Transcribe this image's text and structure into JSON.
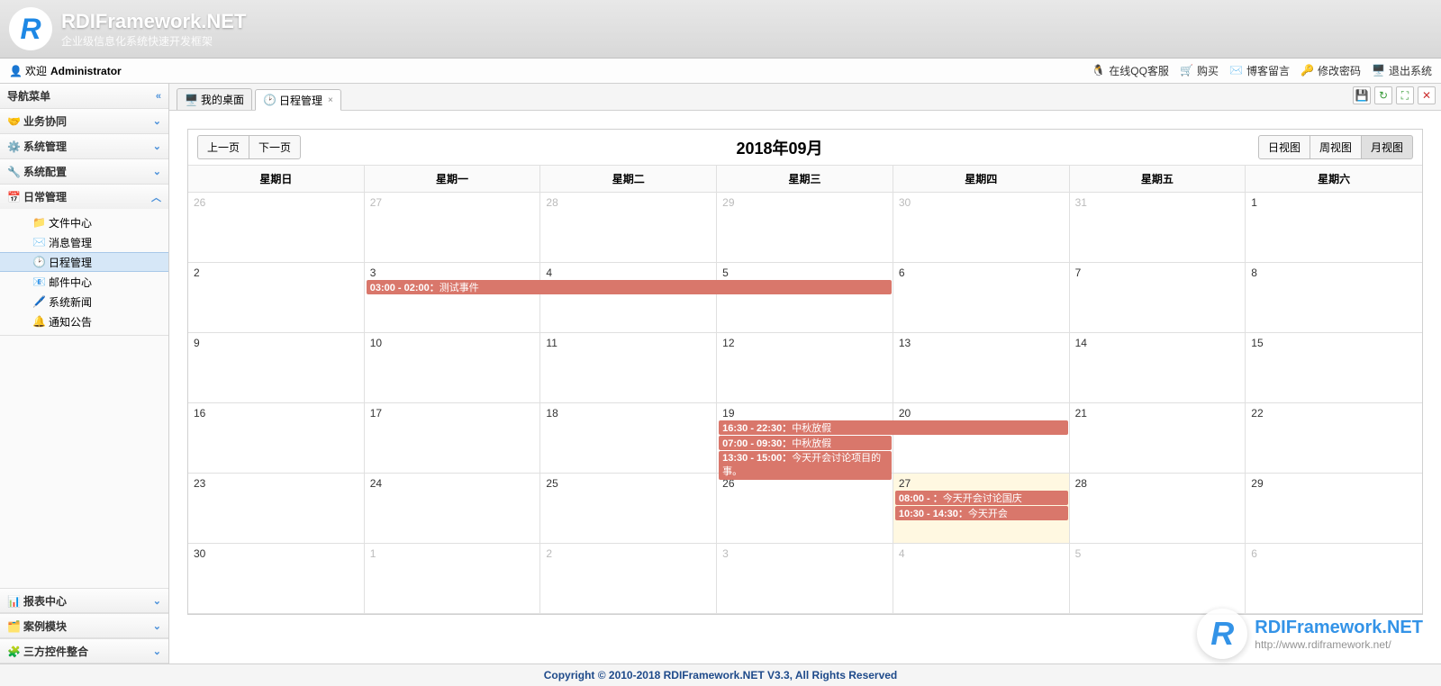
{
  "brand": {
    "name": "RDIFramework.NET",
    "tagline": "企业级信息化系统快速开发框架"
  },
  "welcome": {
    "prefix": "欢迎",
    "user": "Administrator"
  },
  "header_links": {
    "qq": "在线QQ客服",
    "buy": "购买",
    "blog": "博客留言",
    "pwd": "修改密码",
    "exit": "退出系统"
  },
  "sidebar": {
    "nav_title": "导航菜单",
    "groups": {
      "biz": "业务协同",
      "sys_mgmt": "系统管理",
      "sys_cfg": "系统配置",
      "daily": "日常管理",
      "report": "报表中心",
      "example": "案例模块",
      "thirdparty": "三方控件整合"
    },
    "daily_items": {
      "file": "文件中心",
      "msg": "消息管理",
      "schedule": "日程管理",
      "mail": "邮件中心",
      "news": "系统新闻",
      "notice": "通知公告"
    }
  },
  "tabs": {
    "desktop": "我的桌面",
    "schedule": "日程管理"
  },
  "calendar": {
    "prev": "上一页",
    "next": "下一页",
    "title": "2018年09月",
    "view_day": "日视图",
    "view_week": "周视图",
    "view_month": "月视图",
    "weekdays": [
      "星期日",
      "星期一",
      "星期二",
      "星期三",
      "星期四",
      "星期五",
      "星期六"
    ],
    "grid": [
      {
        "n": "26",
        "o": true
      },
      {
        "n": "27",
        "o": true
      },
      {
        "n": "28",
        "o": true
      },
      {
        "n": "29",
        "o": true
      },
      {
        "n": "30",
        "o": true
      },
      {
        "n": "31",
        "o": true
      },
      {
        "n": "1"
      },
      {
        "n": "2"
      },
      {
        "n": "3"
      },
      {
        "n": "4"
      },
      {
        "n": "5"
      },
      {
        "n": "6"
      },
      {
        "n": "7"
      },
      {
        "n": "8"
      },
      {
        "n": "9"
      },
      {
        "n": "10"
      },
      {
        "n": "11"
      },
      {
        "n": "12"
      },
      {
        "n": "13"
      },
      {
        "n": "14"
      },
      {
        "n": "15"
      },
      {
        "n": "16"
      },
      {
        "n": "17"
      },
      {
        "n": "18"
      },
      {
        "n": "19"
      },
      {
        "n": "20"
      },
      {
        "n": "21"
      },
      {
        "n": "22"
      },
      {
        "n": "23"
      },
      {
        "n": "24"
      },
      {
        "n": "25"
      },
      {
        "n": "26"
      },
      {
        "n": "27",
        "t": true
      },
      {
        "n": "28"
      },
      {
        "n": "29"
      },
      {
        "n": "30"
      },
      {
        "n": "1",
        "o": true
      },
      {
        "n": "2",
        "o": true
      },
      {
        "n": "3",
        "o": true
      },
      {
        "n": "4",
        "o": true
      },
      {
        "n": "5",
        "o": true
      },
      {
        "n": "6",
        "o": true
      }
    ],
    "events": {
      "e1": {
        "time": "03:00 - 02:00：",
        "title": "测试事件"
      },
      "e2": {
        "time": "16:30 - 22:30：",
        "title": "中秋放假"
      },
      "e3": {
        "time": "07:00 - 09:30：",
        "title": "中秋放假"
      },
      "e4": {
        "time": "13:30 - 15:00：",
        "title": "今天开会讨论项目的事。"
      },
      "e5": {
        "time": "08:00 -  ：",
        "title": "今天开会讨论国庆"
      },
      "e6": {
        "time": "10:30 - 14:30：",
        "title": "今天开会"
      }
    }
  },
  "footer": "Copyright © 2010-2018 RDIFramework.NET V3.3, All Rights Reserved",
  "watermark": {
    "name": "RDIFramework.NET",
    "url": "http://www.rdiframework.net/"
  },
  "colors": {
    "event_bg": "#d9776b",
    "accent": "#1e88e5",
    "today_bg": "#fff8e1"
  }
}
